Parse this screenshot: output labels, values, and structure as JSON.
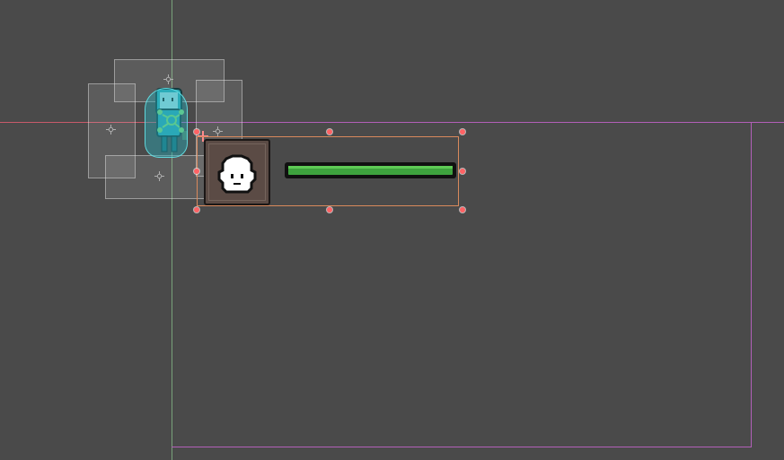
{
  "scene": {
    "player_health_fraction": 1.0,
    "icons": [
      "move-gizmo-icon",
      "rect-handle-icon",
      "player-sprite",
      "ghost-portrait-icon"
    ],
    "colors": {
      "background": "#4a4a4a",
      "camera_bounds": "#b25fb8",
      "x_axis": "#c85a6a",
      "y_axis": "#79a37a",
      "selection": "#d9895c",
      "handle": "#ff6264",
      "health_fill": "#3ea33e",
      "health_highlight": "#5ecb55",
      "collider": "#26b1be"
    }
  }
}
